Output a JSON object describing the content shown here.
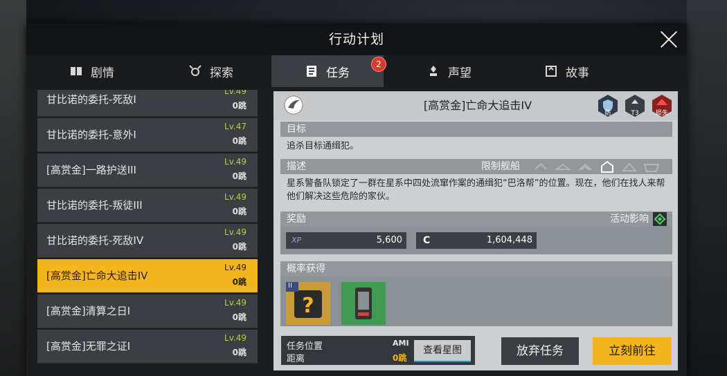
{
  "window": {
    "title": "行动计划"
  },
  "tabs": [
    {
      "label": "剧情",
      "icon": "book-icon"
    },
    {
      "label": "探索",
      "icon": "explore-icon"
    },
    {
      "label": "任务",
      "icon": "task-list-icon",
      "active": true,
      "badge": "2"
    },
    {
      "label": "声望",
      "icon": "reputation-icon"
    },
    {
      "label": "故事",
      "icon": "story-icon"
    }
  ],
  "missions": [
    {
      "name": "甘比诺的委托-死敌I",
      "level": "Lv.49",
      "jumps": "0跳"
    },
    {
      "name": "甘比诺的委托-意外I",
      "level": "Lv.47",
      "jumps": "0跳"
    },
    {
      "name": "[高赏金]一路护送III",
      "level": "Lv.49",
      "jumps": "0跳"
    },
    {
      "name": "甘比诺的委托-叛徒III",
      "level": "Lv.49",
      "jumps": "0跳"
    },
    {
      "name": "甘比诺的委托-死敌IV",
      "level": "Lv.49",
      "jumps": "0跳"
    },
    {
      "name": "[高赏金]亡命大追击IV",
      "level": "Lv.49",
      "jumps": "0跳",
      "selected": true
    },
    {
      "name": "[高赏金]清算之日I",
      "level": "Lv.49",
      "jumps": "0跳"
    },
    {
      "name": "[高赏金]无罪之证I",
      "level": "Lv.49",
      "jumps": "0跳"
    }
  ],
  "detail": {
    "title": "[高赏金]亡命大追击IV",
    "badges": [
      {
        "label": "防",
        "icon": "defense-shield-icon"
      },
      {
        "label": "T3",
        "icon": "tier-icon"
      },
      {
        "label": "损失",
        "icon": "loss-warning-icon"
      }
    ],
    "objective_header": "目标",
    "objective_text": "追杀目标通缉犯。",
    "description_header": "描述",
    "ship_limit_label": "限制舰船",
    "description_text": "星系警备队锁定了一群在星系中四处流窜作案的通缉犯“巴洛帮”的位置。现在，他们在找人来帮他们解决这些危险的家伙。",
    "rewards_header": "奖励",
    "activity_label": "活动影响",
    "xp_tag": "XP",
    "xp_value": "5,600",
    "credit_tag": "C",
    "credit_value": "1,604,448",
    "drops_header": "概率获得",
    "drop_badge": "II"
  },
  "location": {
    "label_line1": "任务位置",
    "label_line2": "距离",
    "system": "AMI",
    "distance": "0跳",
    "map_button": "查看星图"
  },
  "actions": {
    "abandon": "放弃任务",
    "go": "立刻前往"
  },
  "colors": {
    "accent": "#f4b51e",
    "level": "#b6d23c",
    "badge": "#d83a2e"
  }
}
